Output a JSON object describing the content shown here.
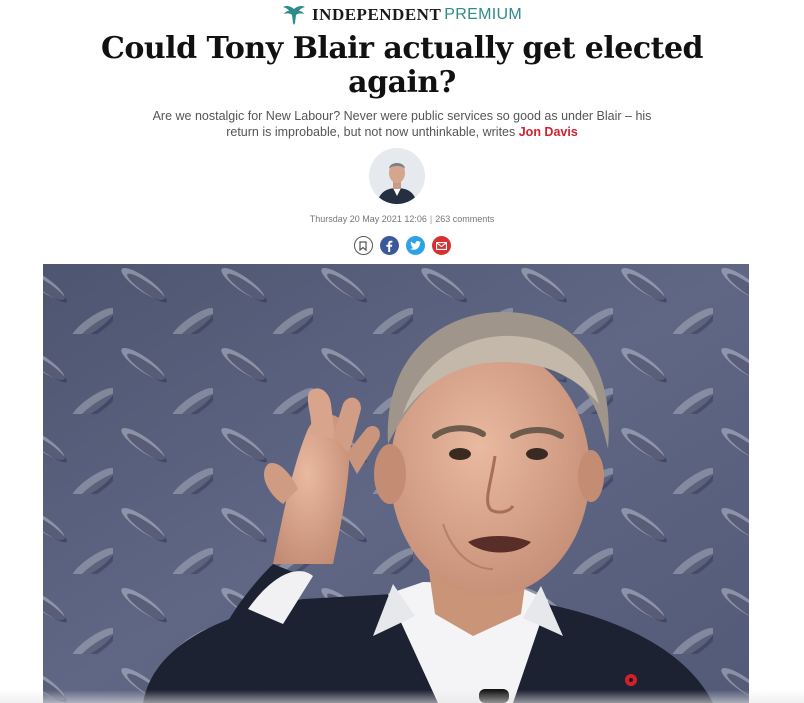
{
  "masthead": {
    "brand": "INDEPENDENT",
    "tier": "PREMIUM",
    "colors": {
      "brand": "#1a1a1a",
      "premium": "#2f8b89"
    }
  },
  "article": {
    "headline": "Could Tony Blair actually get elected again?",
    "standfirst": "Are we nostalgic for New Labour? Never were public services so good as under Blair – his return is improbable, but not now unthinkable, writes ",
    "author": "Jon Davis",
    "date": "Thursday 20 May 2021 12:06",
    "comments": "263 comments"
  },
  "share": {
    "icons": [
      "bookmark-icon",
      "facebook-icon",
      "twitter-icon",
      "email-icon"
    ],
    "colors": {
      "facebook": "#3b5998",
      "twitter": "#2da2e6",
      "email": "#d63132",
      "accent": "#d3202f"
    }
  }
}
